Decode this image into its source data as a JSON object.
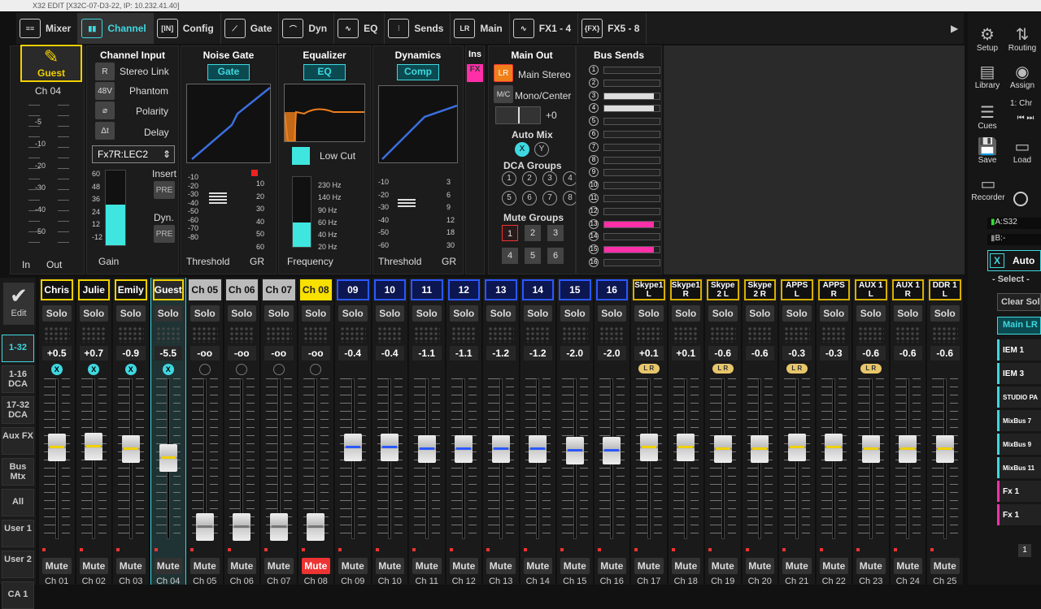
{
  "window_title": "X32 EDIT [X32C-07-D3-22, IP: 10.232.41.40]",
  "nav": [
    {
      "name": "Mixer",
      "icon": "≡≡",
      "active": false
    },
    {
      "name": "Channel",
      "icon": "▮▮",
      "active": true
    },
    {
      "name": "Config",
      "icon": "[IN]",
      "active": false
    },
    {
      "name": "Gate",
      "icon": "⟋",
      "active": false
    },
    {
      "name": "Dyn",
      "icon": "⌒",
      "active": false
    },
    {
      "name": "EQ",
      "icon": "∿",
      "active": false
    },
    {
      "name": "Sends",
      "icon": "⫶",
      "active": false
    },
    {
      "name": "Main",
      "icon": "LR",
      "active": false
    },
    {
      "name": "FX1 - 4",
      "icon": "∿",
      "active": false
    },
    {
      "name": "FX5 - 8",
      "icon": "{FX}",
      "active": false
    }
  ],
  "right": {
    "setup": "Setup",
    "routing": "Routing",
    "library": "Library",
    "assign": "Assign",
    "assign_val": "1: Chr",
    "cues": "Cues",
    "save": "Save",
    "load": "Load",
    "recorder": "Recorder",
    "meter_a": "A:S32",
    "meter_b": "B:-",
    "auto": "Auto",
    "select": "- Select -",
    "clear_solo": "Clear Solo",
    "main_lr": "Main LR",
    "list": [
      {
        "t": "IEM 1",
        "pink": false
      },
      {
        "t": "IEM 3",
        "pink": false
      },
      {
        "t": "STUDIO PA",
        "pink": false
      },
      {
        "t": "MixBus 7",
        "pink": false
      },
      {
        "t": "MixBus 9",
        "pink": false
      },
      {
        "t": "MixBus 11",
        "pink": false
      },
      {
        "t": "Fx 1",
        "pink": true
      },
      {
        "t": "Fx 1",
        "pink": true
      }
    ],
    "bottom_num": "1"
  },
  "channel": {
    "name": "Guest",
    "id": "Ch 04",
    "in_label": "In",
    "out_label": "Out",
    "ch_input": "Channel Input",
    "stereo_link": "Stereo Link",
    "phantom": "Phantom",
    "polarity": "Polarity",
    "delay": "Delay",
    "source": "Fx7R:LEC2",
    "insert": "Insert",
    "dyn": "Dyn.",
    "pre": "PRE",
    "gain": "Gain",
    "meter_scale": [
      "-5",
      "-10",
      "-20",
      "-30",
      "-40",
      "-50"
    ],
    "gain_scale": [
      "60",
      "48",
      "36",
      "24",
      "12",
      "-12"
    ]
  },
  "gate": {
    "title": "Noise Gate",
    "btn": "Gate",
    "threshold": "Threshold",
    "gr": "GR",
    "left": [
      "-10",
      "-20",
      "-30",
      "-40",
      "-50",
      "-60",
      "-70",
      "-80"
    ],
    "right": [
      "10",
      "20",
      "30",
      "40",
      "50",
      "60"
    ]
  },
  "eq": {
    "title": "Equalizer",
    "btn": "EQ",
    "low_cut": "Low Cut",
    "frequency": "Frequency",
    "scale": [
      "230 Hz",
      "140 Hz",
      "90 Hz",
      "60 Hz",
      "40 Hz",
      "20 Hz"
    ]
  },
  "dyn": {
    "title": "Dynamics",
    "btn": "Comp",
    "threshold": "Threshold",
    "gr": "GR",
    "left": [
      "-10",
      "-20",
      "-30",
      "-40",
      "-50",
      "-60"
    ],
    "right": [
      "3",
      "6",
      "9",
      "12",
      "18",
      "30"
    ]
  },
  "ins": {
    "title": "Ins",
    "fx": "FX"
  },
  "main_out": {
    "title": "Main Out",
    "lr": "LR",
    "main_stereo": "Main Stereo",
    "mc": "M/C",
    "mono_center": "Mono/Center",
    "pan": "+0",
    "automix": "Auto Mix",
    "x": "X",
    "y": "Y",
    "dca": "DCA Groups",
    "dca_nums": [
      "1",
      "2",
      "3",
      "4",
      "5",
      "6",
      "7",
      "8"
    ],
    "mute_groups": "Mute Groups",
    "mute_nums": [
      "1",
      "2",
      "3",
      "4",
      "5",
      "6"
    ]
  },
  "bus_sends": {
    "title": "Bus Sends",
    "rows": [
      {
        "n": "1",
        "f": 0
      },
      {
        "n": "2",
        "f": 0
      },
      {
        "n": "3",
        "f": 0.9
      },
      {
        "n": "4",
        "f": 0.9
      },
      {
        "n": "5",
        "f": 0
      },
      {
        "n": "6",
        "f": 0
      },
      {
        "n": "7",
        "f": 0
      },
      {
        "n": "8",
        "f": 0
      },
      {
        "n": "9",
        "f": 0
      },
      {
        "n": "10",
        "f": 0
      },
      {
        "n": "11",
        "f": 0
      },
      {
        "n": "12",
        "f": 0
      },
      {
        "n": "13",
        "f": 0.9,
        "p": true
      },
      {
        "n": "14",
        "f": 0
      },
      {
        "n": "15",
        "f": 0.9,
        "p": true
      },
      {
        "n": "16",
        "f": 0
      }
    ]
  },
  "left": {
    "edit": "Edit",
    "items": [
      "1-32",
      "1-16 DCA",
      "17-32 DCA",
      "Aux FX",
      "Bus Mtx",
      "All",
      "User 1",
      "User 2",
      "CA 1"
    ]
  },
  "mute_label": "Mute",
  "solo_label": "Solo",
  "strips": [
    {
      "name": "Chris",
      "id": "Ch 01",
      "val": "+0.5",
      "type": "y",
      "mark": "X",
      "fader": 0.62
    },
    {
      "name": "Julie",
      "id": "Ch 02",
      "val": "+0.7",
      "type": "y",
      "mark": "X",
      "fader": 0.63
    },
    {
      "name": "Emily",
      "id": "Ch 03",
      "val": "-0.9",
      "type": "y",
      "mark": "X",
      "fader": 0.61
    },
    {
      "name": "Guest",
      "id": "Ch 04",
      "val": "-5.5",
      "type": "y",
      "mark": "X",
      "fader": 0.55,
      "sel": true
    },
    {
      "name": "Ch 05",
      "id": "Ch 05",
      "val": "-oo",
      "type": "g",
      "fader": 0.08
    },
    {
      "name": "Ch 06",
      "id": "Ch 06",
      "val": "-oo",
      "type": "g",
      "fader": 0.08
    },
    {
      "name": "Ch 07",
      "id": "Ch 07",
      "val": "-oo",
      "type": "g",
      "fader": 0.08
    },
    {
      "name": "Ch 08",
      "id": "Ch 08",
      "val": "-oo",
      "type": "yb",
      "fader": 0.08,
      "muted": true
    },
    {
      "name": "09",
      "id": "Ch 09",
      "val": "-0.4",
      "type": "b",
      "fader": 0.62
    },
    {
      "name": "10",
      "id": "Ch 10",
      "val": "-0.4",
      "type": "b",
      "fader": 0.62
    },
    {
      "name": "11",
      "id": "Ch 11",
      "val": "-1.1",
      "type": "b",
      "fader": 0.61
    },
    {
      "name": "12",
      "id": "Ch 12",
      "val": "-1.1",
      "type": "b",
      "fader": 0.61
    },
    {
      "name": "13",
      "id": "Ch 13",
      "val": "-1.2",
      "type": "b",
      "fader": 0.61
    },
    {
      "name": "14",
      "id": "Ch 14",
      "val": "-1.2",
      "type": "b",
      "fader": 0.61
    },
    {
      "name": "15",
      "id": "Ch 15",
      "val": "-2.0",
      "type": "b",
      "fader": 0.6
    },
    {
      "name": "16",
      "id": "Ch 16",
      "val": "-2.0",
      "type": "b",
      "fader": 0.6
    },
    {
      "name": "Skype1 L",
      "id": "Ch 17",
      "val": "+0.1",
      "type": "o",
      "lr": true,
      "fader": 0.62
    },
    {
      "name": "Skype1 R",
      "id": "Ch 18",
      "val": "+0.1",
      "type": "o",
      "fader": 0.62
    },
    {
      "name": "Skype 2 L",
      "id": "Ch 19",
      "val": "-0.6",
      "type": "o",
      "lr": true,
      "fader": 0.61
    },
    {
      "name": "Skype 2 R",
      "id": "Ch 20",
      "val": "-0.6",
      "type": "o",
      "fader": 0.61
    },
    {
      "name": "APPS L",
      "id": "Ch 21",
      "val": "-0.3",
      "type": "o",
      "lr": true,
      "fader": 0.62
    },
    {
      "name": "APPS R",
      "id": "Ch 22",
      "val": "-0.3",
      "type": "o",
      "fader": 0.62
    },
    {
      "name": "AUX 1 L",
      "id": "Ch 23",
      "val": "-0.6",
      "type": "o",
      "lr": true,
      "fader": 0.61
    },
    {
      "name": "AUX 1 R",
      "id": "Ch 24",
      "val": "-0.6",
      "type": "o",
      "fader": 0.61
    },
    {
      "name": "DDR 1 L",
      "id": "Ch 25",
      "val": "-0.6",
      "type": "o",
      "fader": 0.61
    }
  ]
}
